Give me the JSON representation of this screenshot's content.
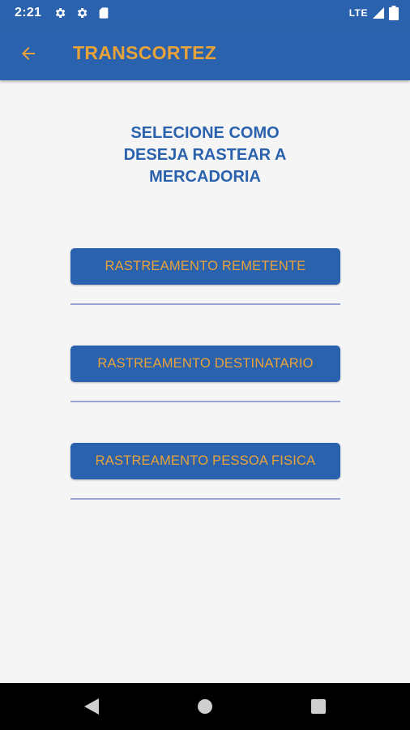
{
  "status_bar": {
    "time": "2:21",
    "network": "LTE",
    "icons": [
      "gear-icon",
      "gear-icon",
      "sd-card-icon",
      "signal-icon",
      "battery-icon"
    ]
  },
  "app_bar": {
    "title": "TRANSCORTEZ",
    "back_icon": "arrow-left-icon"
  },
  "heading": {
    "line1": "SELECIONE COMO",
    "line2": "DESEJA RASTEAR A",
    "line3": "MERCADORIA"
  },
  "buttons": [
    {
      "label": "RASTREAMENTO REMETENTE"
    },
    {
      "label": "RASTREAMENTO DESTINATARIO"
    },
    {
      "label": "RASTREAMENTO PESSOA FISICA"
    }
  ],
  "nav_bar": {
    "icons": [
      "back-triangle-icon",
      "home-circle-icon",
      "recents-square-icon"
    ]
  },
  "colors": {
    "primary": "#2b62ad",
    "accent": "#e8a23a",
    "background": "#f5f5f5",
    "divider": "#9aa3cf"
  }
}
